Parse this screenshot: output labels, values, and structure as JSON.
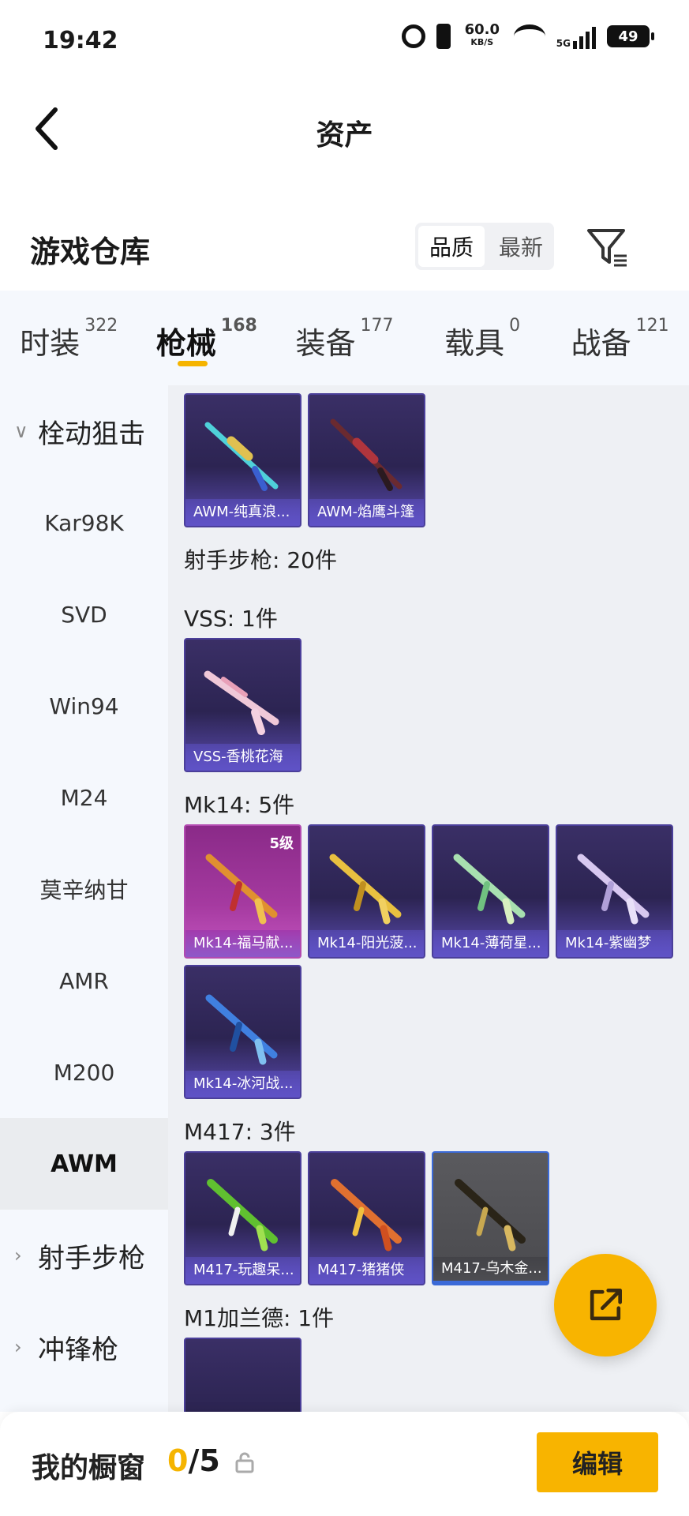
{
  "status_bar": {
    "time": "19:42",
    "net_speed": "60.0",
    "net_unit": "KB/S",
    "signal": "5G",
    "battery": "49"
  },
  "header": {
    "title": "资产"
  },
  "warehouse": {
    "title": "游戏仓库",
    "sort_options": [
      "品质",
      "最新"
    ],
    "active_sort": "品质"
  },
  "tabs": [
    {
      "label": "时装",
      "count": "322"
    },
    {
      "label": "枪械",
      "count": "168"
    },
    {
      "label": "装备",
      "count": "177"
    },
    {
      "label": "载具",
      "count": "0"
    },
    {
      "label": "战备",
      "count": "121"
    }
  ],
  "sidebar": {
    "group_sniper": "栓动狙击",
    "items": [
      "Kar98K",
      "SVD",
      "Win94",
      "M24",
      "莫辛纳甘",
      "AMR",
      "M200",
      "AWM"
    ],
    "active": "AWM",
    "group_marksman": "射手步枪",
    "group_smg": "冲锋枪"
  },
  "content": {
    "awm_items": [
      "AWM-纯真浪...",
      "AWM-焰鹰斗篷"
    ],
    "marksman_header": "射手步枪: 20件",
    "vss_header": "VSS: 1件",
    "vss_items": [
      "VSS-香桃花海"
    ],
    "mk14_header": "Mk14: 5件",
    "mk14_items": [
      "Mk14-福马献...",
      "Mk14-阳光菠...",
      "Mk14-薄荷星...",
      "Mk14-紫幽梦",
      "Mk14-冰河战..."
    ],
    "mk14_level": "5级",
    "m417_header": "M417: 3件",
    "m417_items": [
      "M417-玩趣呆...",
      "M417-猪猪侠",
      "M417-乌木金..."
    ],
    "m1_header": "M1加兰德: 1件"
  },
  "bottom": {
    "showcase_label": "我的橱窗",
    "current": "0",
    "separator": "/",
    "max": "5",
    "edit": "编辑"
  },
  "colors": {
    "accent": "#f8b400",
    "card_purple": "#2c2452",
    "card_pink": "#a53aa0",
    "card_grey": "#4a4a4e"
  }
}
